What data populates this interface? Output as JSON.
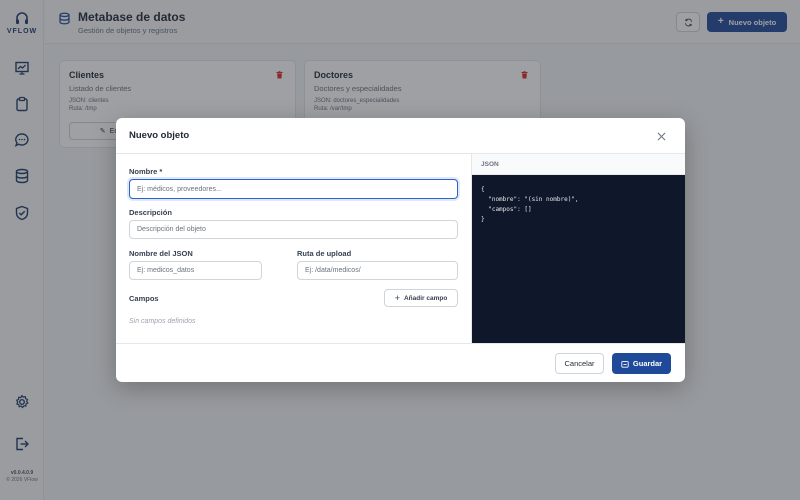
{
  "app": {
    "logo_text": "VFLOW",
    "version": "v0.0.4.0.9",
    "copyright": "© 2026 VFlow"
  },
  "sidebar": {
    "items": [
      {
        "icon": "presentation-chart-icon"
      },
      {
        "icon": "clipboard-icon"
      },
      {
        "icon": "chat-bubble-icon"
      },
      {
        "icon": "database-icon"
      },
      {
        "icon": "shield-check-icon"
      }
    ],
    "bottom_items": [
      {
        "icon": "gear-icon"
      },
      {
        "icon": "logout-icon"
      }
    ]
  },
  "header": {
    "title": "Metabase de datos",
    "subtitle": "Gestión de objetos y registros",
    "new_button_label": "Nuevo objeto"
  },
  "cards": [
    {
      "title": "Clientes",
      "description": "Listado de clientes",
      "json": "JSON: clientes",
      "route": "Ruta: /tmp",
      "edit_label": "Ed"
    },
    {
      "title": "Doctores",
      "description": "Doctores y especialidades",
      "json": "JSON: doctores_especialidades",
      "route": "Ruta: /var/tmp"
    }
  ],
  "modal": {
    "title": "Nuevo objeto",
    "fields": {
      "name_label": "Nombre *",
      "name_placeholder": "Ej: médicos, proveedores...",
      "description_label": "Descripción",
      "description_placeholder": "Descripción del objeto",
      "json_name_label": "Nombre del JSON",
      "json_name_placeholder": "Ej: medicos_datos",
      "upload_route_label": "Ruta de upload",
      "upload_route_placeholder": "Ej: /data/medicos/",
      "fields_label": "Campos",
      "add_field_label": "Añadir campo",
      "empty_fields_note": "Sin campos definidos"
    },
    "json_panel": {
      "label": "JSON",
      "code": "{\n  \"nombre\": \"(sin nombre)\",\n  \"campos\": []\n}"
    },
    "footer": {
      "cancel_label": "Cancelar",
      "save_label": "Guardar"
    }
  },
  "colors": {
    "primary": "#1f4a99",
    "focus": "#2b63c8",
    "danger": "#dc2626",
    "code_bg": "#0f172a"
  }
}
